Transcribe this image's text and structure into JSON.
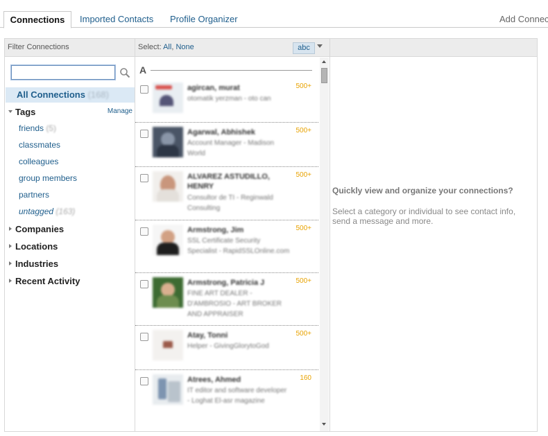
{
  "tabs": {
    "connections": "Connections",
    "imported": "Imported Contacts",
    "profile": "Profile Organizer",
    "add": "Add Connec"
  },
  "header": {
    "filter_label": "Filter Connections",
    "select_prefix": "Select:",
    "select_all": "All",
    "select_sep": ",",
    "select_none": "None",
    "sort_label": "abc"
  },
  "sidebar": {
    "search_placeholder": "",
    "all_connections": "All Connections",
    "all_count": "(168)",
    "tags_label": "Tags",
    "manage_label": "Manage",
    "tags": [
      {
        "label": "friends",
        "count": "(5)"
      },
      {
        "label": "classmates",
        "count": ""
      },
      {
        "label": "colleagues",
        "count": ""
      },
      {
        "label": "group members",
        "count": ""
      },
      {
        "label": "partners",
        "count": ""
      },
      {
        "label": "untagged",
        "count": "(163)"
      }
    ],
    "sections": [
      "Companies",
      "Locations",
      "Industries",
      "Recent Activity"
    ]
  },
  "list": {
    "letter": "A",
    "contacts": [
      {
        "name": "agircan, murat",
        "title": "otomatik yerzman - oto can",
        "degree": "500+"
      },
      {
        "name": "Agarwal, Abhishek",
        "title": "Account Manager - Madison World",
        "degree": "500+"
      },
      {
        "name": "ALVAREZ ASTUDILLO, HENRY",
        "title": "Consultor de TI - Reginwald Consulting",
        "degree": "500+"
      },
      {
        "name": "Armstrong, Jim",
        "title": "SSL Certificate Security Specialist - RapidSSLOnline.com",
        "degree": "500+"
      },
      {
        "name": "Armstrong, Patricia J",
        "title": "FINE ART DEALER - D'AMBROSIO - ART BROKER AND APPRAISER",
        "degree": "500+"
      },
      {
        "name": "Atay, Tonni",
        "title": "Helper - GivingGlorytoGod",
        "degree": "500+"
      },
      {
        "name": "Atrees, Ahmed",
        "title": "IT editor and software developer - Loghat El-asr magazine",
        "degree": "160"
      }
    ]
  },
  "info": {
    "title": "Quickly view and organize your connections?",
    "desc": "Select a category or individual to see contact info, send a message and more."
  },
  "colors": {
    "link": "#1f5e8c",
    "degree": "#e8a200",
    "selected_bg": "#dbe9f5"
  }
}
